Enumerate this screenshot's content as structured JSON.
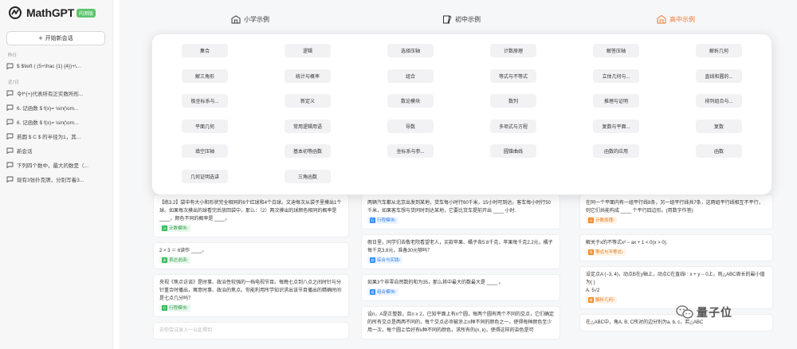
{
  "app": {
    "name": "MathGPT",
    "badge": "内测版"
  },
  "sidebar": {
    "new_chat_label": "开始新会话",
    "group_today": "昨日",
    "group_week": "近7日",
    "today_items": [
      "$ $\\left ( (5+\\frac {1} {4})+\\..."
    ],
    "week_items": [
      "令f^{+}代表所有正实数所形...",
      "6. 记函数 $ f(x)= \\sin(\\om...",
      "6. 记函数 $ f(x)= \\sin(\\om...",
      "若圆 $ C $ 的半径为1，其...",
      "新会话",
      "下列四个数中，最大的数是（...",
      "现有3张扑克牌，分别写着3..."
    ]
  },
  "tabs": [
    {
      "label": "小学示例",
      "icon": "school-icon"
    },
    {
      "label": "初中示例",
      "icon": "pencil-book-icon"
    },
    {
      "label": "高中示例",
      "icon": "building-icon",
      "active": true
    }
  ],
  "colors": {
    "accent": "#f07a2e",
    "blue_tag": "#2b7de9",
    "green_tag": "#2f9a45",
    "brand_badge": "#5cc46b"
  },
  "topics": [
    [
      "集合",
      "逻辑",
      "选择压轴",
      "计数原理",
      "解答压轴",
      "解析几何"
    ],
    [
      "解三角形",
      "统计与概率",
      "组合",
      "等式与不等式",
      "立体几何与...",
      "直线和圆的..."
    ],
    [
      "极坐标系与...",
      "新定义",
      "数论模块",
      "数列",
      "推理与证明",
      "排列组合与..."
    ],
    [
      "平面几何",
      "常用逻辑用语",
      "导数",
      "多项式与方程",
      "复数与平面...",
      "复数"
    ],
    [
      "填空压轴",
      "基本初等函数",
      "坐标系与参...",
      "圆锥曲线",
      "函数的应用",
      "函数"
    ],
    [
      "几何证明选讲",
      "三角函数"
    ]
  ],
  "content": {
    "col1": [
      {
        "text": "【练3.2】袋中有大小和形状完全相同的6个红球和4个白球。文迪每次从袋子里摸出1个球。如果每次摸出的球看完后放回袋中，那么：（2）两次摸出的球颜色相同的概率是 ____，颜色不同的概率是 ____。",
        "tag": "计数模块",
        "tag_style": "green"
      },
      {
        "text": "2 × 3 ＝ 6读作 ____。",
        "tag": "表达说读",
        "tag_style": "green"
      },
      {
        "text": "央视《焦点访谈》是时事、政治性较强的一档电视节目。每晚七点到八点之间时针与分针重合时播出，寓意时事、政治的焦点。你能利用所学知识求出该节目播出的精确时间是七点几分吗？",
        "tag": "行程模块",
        "tag_style": "green"
      },
      {
        "text": "去你尝试录入一以此得到"
      }
    ],
    "col2": [
      {
        "text": "两辆汽车都从北京出发到某地，货车每小时行60千米，15小时可到达。客车每小时行50千米，如果客车想与货同时到达某地，它要比货车提前开出 ____ 小时.",
        "tag": "行程模块",
        "tag_style": "blue"
      },
      {
        "text": "假日里，同学们去敬老院看望老人，买款苹果、橘子各5.8千克，苹果每千克2.2元，橘子每千克3.8元，准备30元够吗？",
        "tag": "综合与实践",
        "tag_style": "blue"
      },
      {
        "text": "如果3个非零自然数的和为35，那么其中最大的数最大是 ____ 。",
        "tag": "组合模块",
        "tag_style": "blue"
      },
      {
        "text": "设n，A是正整数，且n ≥ 2，已知平面上有n个圆，每两个圆有两个不同的交点，它们确定的所有交点是两两不同的，每个交点必须被涂上n种不同的颜色之一，使得每种颜色至少用一次，每个圆上恰好有k种不同的颜色，求所有的(n, k)，使得这样的染色是可"
      }
    ],
    "col3": [
      {
        "text": "在同一个平面内有一组平行线8条，另一组平行线共7条，这两组平行线相互不平行，则它们共能构成 ____ 个平行四边形。(用数字作答)",
        "tag": "计数原理",
        "tag_style": "orange"
      },
      {
        "text": "解关于x的不等式x² − ax + 1 < 0(x > 0).",
        "tag": "等式与不等式",
        "tag_style": "orange"
      },
      {
        "text": "设定点A (−3, 4)，动点B在y轴上，动点C在直线l : x + y − 0上，则△ABC周长的最小值为( )",
        "extra": "A. 5√2",
        "tag": "解析几何",
        "tag_style": "orange"
      },
      {
        "text": "在△ABC中，角A, B, C所对的边分别为a, b, c，若△ABC"
      }
    ]
  },
  "watermark": {
    "text": "量子位"
  }
}
